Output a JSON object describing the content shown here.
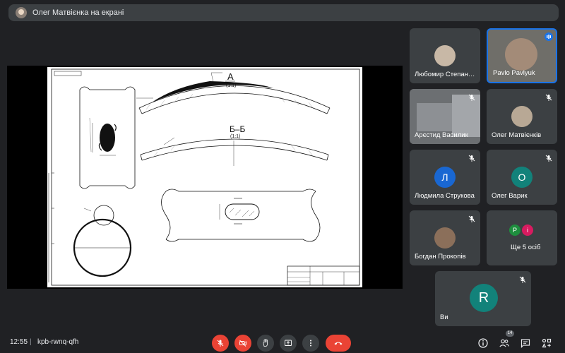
{
  "presenting_banner": {
    "text": "Олег Матвієнка на екрані"
  },
  "participants": [
    {
      "name": "Любомир Степан…",
      "muted": false
    },
    {
      "name": "Pavlo Pavlyuk",
      "muted": false,
      "speaking": true
    },
    {
      "name": "Арєстид Василик",
      "muted": true
    },
    {
      "name": "Олег Матвієнків",
      "muted": true
    },
    {
      "name": "Людмила Струкова",
      "initial": "Л",
      "muted": true
    },
    {
      "name": "Олег Варик",
      "initial": "О",
      "muted": true
    },
    {
      "name": "Богдан Прокопів",
      "muted": true
    },
    {
      "name": "Ще 5 осіб",
      "initials": [
        "P",
        "i"
      ]
    },
    {
      "name": "Ви",
      "initial": "R",
      "muted": true
    }
  ],
  "drawing": {
    "title_a": "А",
    "scale_a": "(1:1)",
    "title_b": "Б–Б",
    "scale_b": "(1:1)"
  },
  "bottom_bar": {
    "time": "12:55",
    "separator": "|",
    "meeting_code": "kpb-rwnq-qfh",
    "people_count": "14"
  },
  "colors": {
    "background": "#202124",
    "tile": "#3c4043",
    "red_control": "#ea4335",
    "dark_control": "#3c4043",
    "speaking": "#1a73e8"
  }
}
